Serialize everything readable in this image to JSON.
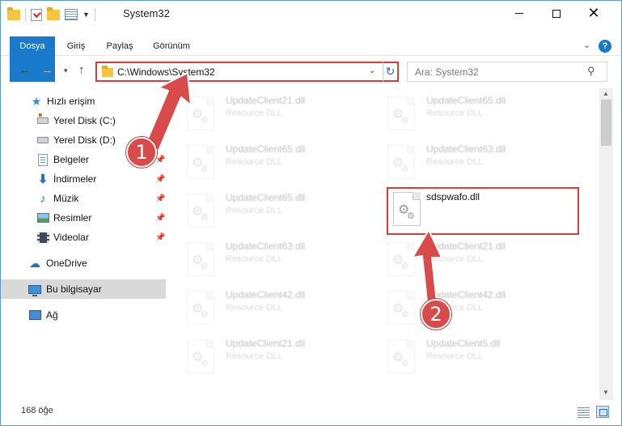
{
  "window": {
    "title": "System32",
    "colors": {
      "accent": "#1979ca",
      "annotation": "#e03a3a",
      "selected_bg": "#d9d9d9"
    }
  },
  "titlebar": {
    "quick_access_icons": [
      "folder-icon",
      "properties-check-icon",
      "new-folder-icon",
      "properties-icon"
    ],
    "minimize_label": "",
    "maximize_label": "",
    "close_label": "✕"
  },
  "ribbon": {
    "tabs": [
      {
        "label": "Dosya",
        "active": true
      },
      {
        "label": "Giriş"
      },
      {
        "label": "Paylaş"
      },
      {
        "label": "Görünüm"
      }
    ],
    "expand_label": "⌄",
    "help_label": "?"
  },
  "nav": {
    "back": "←",
    "forward": "→",
    "recent": "▾",
    "up": "↑",
    "address_path": "C:\\Windows\\System32",
    "address_dropdown": "⌄",
    "refresh": "↻",
    "search_placeholder": "Ara: System32",
    "search_icon": "⚲"
  },
  "sidebar": {
    "items": [
      {
        "label": "Hızlı erişim",
        "icon": "star-icon",
        "pinned": false
      },
      {
        "label": "Yerel Disk (C:)",
        "icon": "local-disk-c-icon",
        "pinned": false
      },
      {
        "label": "Yerel Disk (D:)",
        "icon": "local-disk-d-icon",
        "pinned": true
      },
      {
        "label": "Belgeler",
        "icon": "documents-icon",
        "pinned": true
      },
      {
        "label": "İndirmeler",
        "icon": "downloads-icon",
        "pinned": true
      },
      {
        "label": "Müzik",
        "icon": "music-icon",
        "pinned": true
      },
      {
        "label": "Resimler",
        "icon": "pictures-icon",
        "pinned": true
      },
      {
        "label": "Videolar",
        "icon": "videos-icon",
        "pinned": true
      },
      {
        "label": "OneDrive",
        "icon": "onedrive-icon",
        "pinned": false
      },
      {
        "label": "Bu bilgisayar",
        "icon": "this-pc-icon",
        "pinned": false,
        "selected": true
      },
      {
        "label": "Ağ",
        "icon": "network-icon",
        "pinned": false
      }
    ],
    "pin_glyph": "📌"
  },
  "files": [
    {
      "name": "UpdateClient21.dll",
      "type": "Resource DLL",
      "faded": true
    },
    {
      "name": "UpdateClient65.dll",
      "type": "Resource DLL",
      "faded": true
    },
    {
      "name": "UpdateClient65.dll",
      "type": "Resource DLL",
      "faded": true
    },
    {
      "name": "UpdateClient63.dll",
      "type": "Resource DLL",
      "faded": true
    },
    {
      "name": "UpdateClient65.dll",
      "type": "Resource DLL",
      "faded": true
    },
    {
      "name": "sdspwafo.dll",
      "type": "",
      "faded": false,
      "highlighted": true
    },
    {
      "name": "UpdateClient63.dll",
      "type": "Resource DLL",
      "faded": true
    },
    {
      "name": "UpdateClient21.dll",
      "type": "Resource DLL",
      "faded": true
    },
    {
      "name": "UpdateClient42.dll",
      "type": "Resource DLL",
      "faded": true
    },
    {
      "name": "UpdateClient42.dll",
      "type": "Resource DLL",
      "faded": true
    },
    {
      "name": "UpdateClient21.dll",
      "type": "Resource DLL",
      "faded": true
    },
    {
      "name": "UpdateClient5.dll",
      "type": "Resource DLL",
      "faded": true
    }
  ],
  "scrollbar": {
    "up": "▲",
    "down": "▼"
  },
  "status": {
    "item_count": "168 öğe"
  },
  "annotations": [
    {
      "number": "1"
    },
    {
      "number": "2"
    }
  ]
}
